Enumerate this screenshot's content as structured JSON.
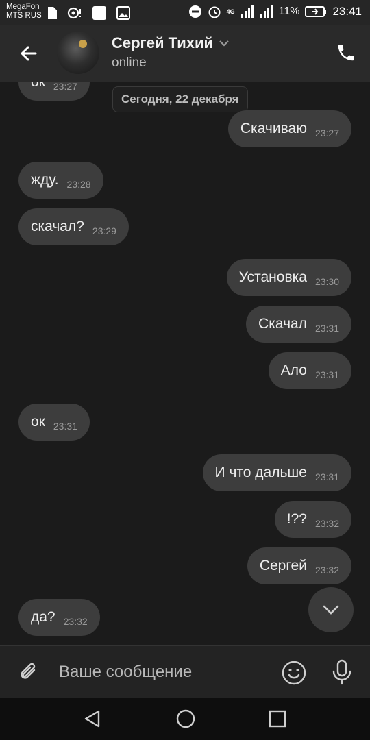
{
  "status_bar": {
    "carrier_line1": "MegaFon",
    "carrier_line2": "MTS RUS",
    "network": "4G",
    "battery_percent": "11%",
    "time": "23:41"
  },
  "header": {
    "contact_name": "Сергей Тихий",
    "contact_status": "online"
  },
  "chat": {
    "date_separator": "Сегодня, 22 декабря",
    "messages": [
      {
        "dir": "in",
        "text": "ок",
        "time": "23:27"
      },
      {
        "dir": "out",
        "text": "Скачиваю",
        "time": "23:27"
      },
      {
        "dir": "in",
        "text": "жду.",
        "time": "23:28"
      },
      {
        "dir": "in",
        "text": "скачал?",
        "time": "23:29"
      },
      {
        "dir": "out",
        "text": "Установка",
        "time": "23:30"
      },
      {
        "dir": "out",
        "text": "Скачал",
        "time": "23:31"
      },
      {
        "dir": "out",
        "text": "Ало",
        "time": "23:31"
      },
      {
        "dir": "in",
        "text": "ок",
        "time": "23:31"
      },
      {
        "dir": "out",
        "text": "И что дальше",
        "time": "23:31"
      },
      {
        "dir": "out",
        "text": "!??",
        "time": "23:32"
      },
      {
        "dir": "out",
        "text": "Сергей",
        "time": "23:32"
      },
      {
        "dir": "in",
        "text": "да?",
        "time": "23:32"
      }
    ]
  },
  "composer": {
    "placeholder": "Ваше сообщение"
  },
  "colors": {
    "background": "#1b1b1b",
    "bubble": "#3d3d3d",
    "header": "#2a2a2a"
  }
}
